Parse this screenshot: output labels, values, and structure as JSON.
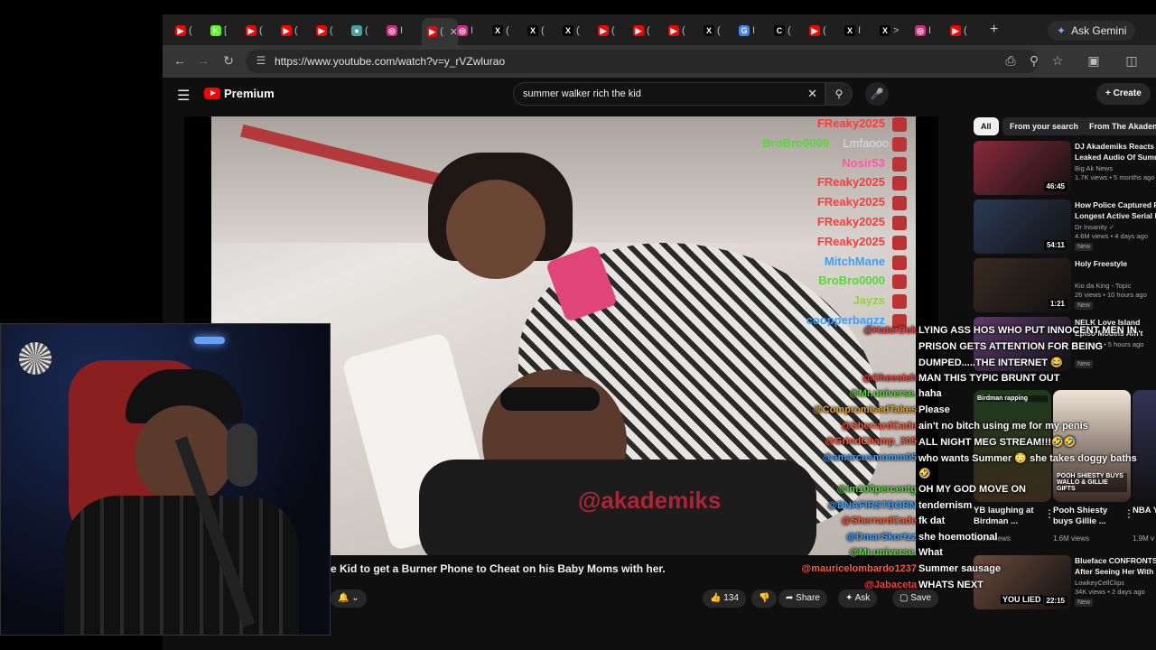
{
  "browser": {
    "tabs": [
      {
        "icon": "youtube-icon",
        "color": "#ff0000",
        "glyph": "▶",
        "label": "("
      },
      {
        "icon": "kick-icon",
        "color": "#53fc18",
        "glyph": "K",
        "label": "["
      },
      {
        "icon": "youtube-icon",
        "color": "#ff0000",
        "glyph": "▶",
        "label": "("
      },
      {
        "icon": "youtube-icon",
        "color": "#ff0000",
        "glyph": "▶",
        "label": "("
      },
      {
        "icon": "youtube-icon",
        "color": "#ff0000",
        "glyph": "▶",
        "label": "("
      },
      {
        "icon": "globe-icon",
        "color": "#4aa3a3",
        "glyph": "●",
        "label": "("
      },
      {
        "icon": "instagram-icon",
        "color": "#d62976",
        "glyph": "◎",
        "label": "I"
      },
      {
        "icon": "youtube-icon",
        "color": "#ff0000",
        "glyph": "▶",
        "label": "("
      },
      {
        "icon": "instagram-icon",
        "color": "#d62976",
        "glyph": "◎",
        "label": "I"
      },
      {
        "icon": "x-icon",
        "color": "#000000",
        "glyph": "X",
        "label": "("
      },
      {
        "icon": "x-icon",
        "color": "#000000",
        "glyph": "X",
        "label": "("
      },
      {
        "icon": "x-icon",
        "color": "#000000",
        "glyph": "X",
        "label": "("
      },
      {
        "icon": "youtube-icon",
        "color": "#ff0000",
        "glyph": "▶",
        "label": "("
      },
      {
        "icon": "youtube-icon",
        "color": "#ff0000",
        "glyph": "▶",
        "label": "("
      },
      {
        "icon": "youtube-icon",
        "color": "#ff0000",
        "glyph": "▶",
        "label": "("
      },
      {
        "icon": "x-icon",
        "color": "#000000",
        "glyph": "X",
        "label": "("
      },
      {
        "icon": "google-icon",
        "color": "#4285f4",
        "glyph": "G",
        "label": "I"
      },
      {
        "icon": "threads-icon",
        "color": "#000000",
        "glyph": "C",
        "label": "("
      },
      {
        "icon": "youtube-icon",
        "color": "#ff0000",
        "glyph": "▶",
        "label": "("
      },
      {
        "icon": "x-icon",
        "color": "#000000",
        "glyph": "X",
        "label": "I"
      },
      {
        "icon": "x-icon",
        "color": "#000000",
        "glyph": "X",
        "label": ">"
      },
      {
        "icon": "instagram-icon",
        "color": "#d62976",
        "glyph": "◎",
        "label": "I"
      },
      {
        "icon": "youtube-icon",
        "color": "#ff0000",
        "glyph": "▶",
        "label": "("
      }
    ],
    "active_tab_close": "✕",
    "new_tab": "+",
    "gemini_label": "Ask Gemini",
    "url": "https://www.youtube.com/watch?v=y_rVZwlurao"
  },
  "youtube": {
    "logo_text": "Premium",
    "search_value": "summer walker rich the kid",
    "create_label": "Create",
    "video_title": "e Kid to get a Burner Phone to Cheat on his Baby Moms with her.",
    "watermark": "@akademiks",
    "like_count": "134",
    "share_label": "Share",
    "ask_label": "Ask",
    "save_label": "Save"
  },
  "overlay_chat": [
    {
      "user": "FReaky2025",
      "color": "#ff3b3b",
      "msg": ""
    },
    {
      "user": "BroBro0000",
      "color": "#5ad63a",
      "msg": "Lmfaooo"
    },
    {
      "user": "Nosir53",
      "color": "#ff5aa0",
      "msg": ""
    },
    {
      "user": "FReaky2025",
      "color": "#ff3b3b",
      "msg": ""
    },
    {
      "user": "FReaky2025",
      "color": "#ff3b3b",
      "msg": ""
    },
    {
      "user": "FReaky2025",
      "color": "#ff3b3b",
      "msg": ""
    },
    {
      "user": "FReaky2025",
      "color": "#ff3b3b",
      "msg": ""
    },
    {
      "user": "MitchMane",
      "color": "#3aa0ff",
      "msg": ""
    },
    {
      "user": "BroBro0000",
      "color": "#5ad63a",
      "msg": ""
    },
    {
      "user": "Jayzs",
      "color": "#8fd43a",
      "msg": ""
    },
    {
      "user": "coopperbagzz",
      "color": "#3aa0ff",
      "msg": ""
    }
  ],
  "side_chat": [
    {
      "user": "@HaterDek",
      "color": "#ff3b3b",
      "msg": "LYING ASS HOS WHO PUT INNOCENT MEN IN"
    },
    {
      "user": "",
      "color": "#ffffff",
      "msg": "PRISON GETS ATTENTION FOR BEING"
    },
    {
      "user": "",
      "color": "#ffffff",
      "msg": "DUMPED.....THE INTERNET 😂"
    },
    {
      "user": "@Oheesieh",
      "color": "#ff3b3b",
      "msg": "MAN THIS TYPIC BRUNT OUT"
    },
    {
      "user": "@Mr.universe.",
      "color": "#5ad63a",
      "msg": "haha"
    },
    {
      "user": "@CompromisedTakes",
      "color": "#e0a020",
      "msg": "Please"
    },
    {
      "user": "@SherrardCade",
      "color": "#ff5a3a",
      "msg": "ain't no bitch using me for my penis"
    },
    {
      "user": "@GrindChamp_305",
      "color": "#ff5a3a",
      "msg": "ALL NIGHT MEG STREAM!!!🤣🤣"
    },
    {
      "user": "@amarcusmomm05",
      "color": "#3aa0ff",
      "msg": "who wants Summer 😳 she takes doggy baths"
    },
    {
      "user": "",
      "color": "#ffffff",
      "msg": "🤣"
    },
    {
      "user": "@im100percentg",
      "color": "#5ad63a",
      "msg": "OH MY GOD MOVE ON"
    },
    {
      "user": "@DNAFIRSTBORN",
      "color": "#3aa0ff",
      "msg": "tendernism"
    },
    {
      "user": "@SherrardCade",
      "color": "#ff5a3a",
      "msg": "fk dat"
    },
    {
      "user": "@DmarSkortzz",
      "color": "#3aa0ff",
      "msg": "she hoemotional"
    },
    {
      "user": "@Mr.universe.",
      "color": "#5ad63a",
      "msg": "What"
    },
    {
      "user": "@mauricelombardo1237",
      "color": "#ff5a3a",
      "msg": "Summer sausage"
    },
    {
      "user": "@Jabaceta",
      "color": "#ff3b3b",
      "msg": "WHATS NEXT"
    }
  ],
  "sidebar": {
    "chips": [
      "All",
      "From your search",
      "From The Akadem"
    ],
    "recs": [
      {
        "title": "DJ Akademiks Reacts Leaked Audio Of Summ",
        "channel": "Big Ak News",
        "meta": "1.7K views • 5 months ago",
        "duration": "46:45",
        "new": "",
        "thumb": "#8a2a3a"
      },
      {
        "title": "How Police Captured F Longest Active Serial K",
        "channel": "Dr Insanity ✓",
        "meta": "4.6M views • 4 days ago",
        "duration": "54:11",
        "new": "New",
        "thumb": "#2a3a55"
      },
      {
        "title": "Holy Freestyle",
        "channel": "Kio da King - Topic",
        "meta": "26 views • 10 hours ago",
        "duration": "1:21",
        "new": "New",
        "thumb": "#3a2a22"
      },
      {
        "title": "NELK Love Island Episo Models Ain't Loyal",
        "channel": "",
        "meta": "5K views • 5 hours ago",
        "duration": "",
        "new": "New",
        "thumb": "#5a3a6a"
      },
      {
        "title": "Blueface CONFRONTS After Seeing Her With",
        "channel": "LowkeyCellClips",
        "meta": "34K views • 2 days ago",
        "duration": "22:15",
        "new": "New",
        "thumb": "#6a4a3a"
      }
    ],
    "shorts": [
      {
        "title": "YB laughing at Birdman ...",
        "views": "828K views",
        "overlay": "Birdman rapping"
      },
      {
        "title": "Pooh Shiesty buys Gillie ...",
        "views": "1.6M views",
        "overlay": "POOH SHIESTY BUYS WALLO & GILLIE GIFTS"
      },
      {
        "title": "NBA YOUNG",
        "views": "1.9M v",
        "overlay": ""
      }
    ],
    "last_rec_overlay": "YOU LIED"
  }
}
